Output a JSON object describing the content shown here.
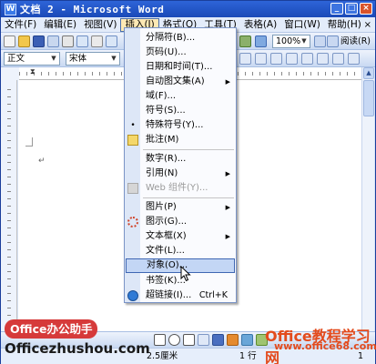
{
  "window": {
    "title": "文档 2 - Microsoft Word",
    "controls": {
      "minimize": "_",
      "maximize": "□",
      "close": "×"
    }
  },
  "menubar": {
    "items": [
      {
        "label": "文件(F)"
      },
      {
        "label": "编辑(E)"
      },
      {
        "label": "视图(V)"
      },
      {
        "label": "插入(I)"
      },
      {
        "label": "格式(O)"
      },
      {
        "label": "工具(T)"
      },
      {
        "label": "表格(A)"
      },
      {
        "label": "窗口(W)"
      },
      {
        "label": "帮助(H)"
      }
    ],
    "active_item": "插入(I)",
    "close_doc": "×"
  },
  "standard_toolbar": {
    "zoom": "100%",
    "read_label": "阅读(R)"
  },
  "format_toolbar": {
    "style": "正文",
    "font": "宋体"
  },
  "insert_menu": {
    "items": [
      {
        "label": "分隔符(B)...",
        "submenu": false,
        "disabled": false
      },
      {
        "label": "页码(U)...",
        "submenu": false,
        "disabled": false
      },
      {
        "label": "日期和时间(T)...",
        "submenu": false,
        "disabled": false
      },
      {
        "label": "自动图文集(A)",
        "submenu": true,
        "disabled": false
      },
      {
        "label": "域(F)...",
        "submenu": false,
        "disabled": false
      },
      {
        "label": "符号(S)...",
        "submenu": false,
        "disabled": false
      },
      {
        "label": "特殊符号(Y)...",
        "submenu": false,
        "disabled": false
      },
      {
        "label": "批注(M)",
        "submenu": false,
        "disabled": false
      },
      {
        "label": "数字(R)...",
        "submenu": false,
        "disabled": false
      },
      {
        "label": "引用(N)",
        "submenu": true,
        "disabled": false
      },
      {
        "label": "Web 组件(Y)...",
        "submenu": false,
        "disabled": true
      },
      {
        "label": "图片(P)",
        "submenu": true,
        "disabled": false
      },
      {
        "label": "图示(G)...",
        "submenu": false,
        "disabled": false
      },
      {
        "label": "文本框(X)",
        "submenu": true,
        "disabled": false
      },
      {
        "label": "文件(L)...",
        "submenu": false,
        "disabled": false
      },
      {
        "label": "对象(O)...",
        "submenu": false,
        "disabled": false,
        "highlighted": true
      },
      {
        "label": "书签(K)...",
        "submenu": false,
        "disabled": false
      },
      {
        "label": "超链接(I)...",
        "submenu": false,
        "disabled": false,
        "shortcut": "Ctrl+K"
      }
    ]
  },
  "statusbar": {
    "position": "2.5厘米",
    "line": "1 行",
    "column": "1"
  },
  "watermarks": {
    "office_badge": "Office办公助手",
    "office_url": "Officezhushou.com",
    "site_cn": "Office教程学习网",
    "site_url": "www.office68.com"
  },
  "colors": {
    "titlebar": "#1a4ab8",
    "menu_highlight": "#c3d6f5",
    "badge_red": "#d63a3a",
    "site_orange": "#e34b1d"
  }
}
